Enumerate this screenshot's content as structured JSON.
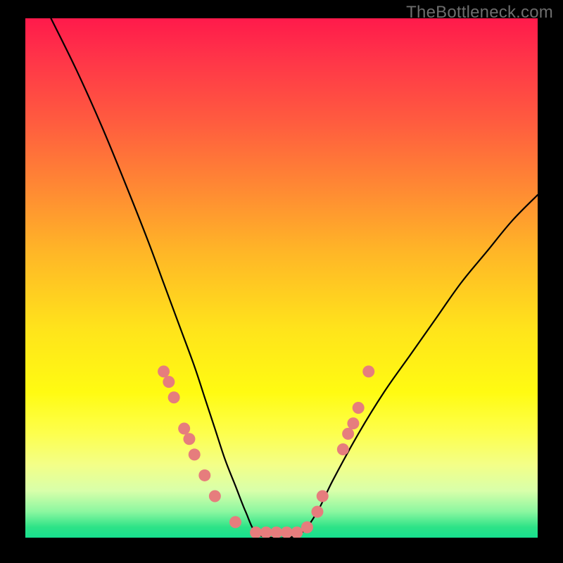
{
  "watermark": "TheBottleneck.com",
  "chart_data": {
    "type": "line",
    "title": "",
    "xlabel": "",
    "ylabel": "",
    "xlim": [
      0,
      100
    ],
    "ylim": [
      0,
      100
    ],
    "series": [
      {
        "name": "bottleneck-curve",
        "x": [
          5,
          10,
          15,
          20,
          24,
          27,
          30,
          33,
          35,
          37,
          39,
          41,
          43,
          45,
          48,
          51,
          54,
          57,
          60,
          65,
          70,
          75,
          80,
          85,
          90,
          95,
          100
        ],
        "y": [
          100,
          90,
          79,
          67,
          57,
          49,
          41,
          33,
          27,
          21,
          15,
          10,
          5,
          1,
          0,
          0,
          1,
          5,
          11,
          20,
          28,
          35,
          42,
          49,
          55,
          61,
          66
        ]
      }
    ],
    "markers": {
      "name": "gpu-points",
      "color": "#e67d7d",
      "points": [
        {
          "x": 27,
          "y": 32
        },
        {
          "x": 28,
          "y": 30
        },
        {
          "x": 29,
          "y": 27
        },
        {
          "x": 31,
          "y": 21
        },
        {
          "x": 32,
          "y": 19
        },
        {
          "x": 33,
          "y": 16
        },
        {
          "x": 35,
          "y": 12
        },
        {
          "x": 37,
          "y": 8
        },
        {
          "x": 41,
          "y": 3
        },
        {
          "x": 45,
          "y": 1
        },
        {
          "x": 47,
          "y": 1
        },
        {
          "x": 49,
          "y": 1
        },
        {
          "x": 51,
          "y": 1
        },
        {
          "x": 53,
          "y": 1
        },
        {
          "x": 55,
          "y": 2
        },
        {
          "x": 57,
          "y": 5
        },
        {
          "x": 58,
          "y": 8
        },
        {
          "x": 62,
          "y": 17
        },
        {
          "x": 63,
          "y": 20
        },
        {
          "x": 64,
          "y": 22
        },
        {
          "x": 65,
          "y": 25
        },
        {
          "x": 67,
          "y": 32
        }
      ]
    }
  }
}
